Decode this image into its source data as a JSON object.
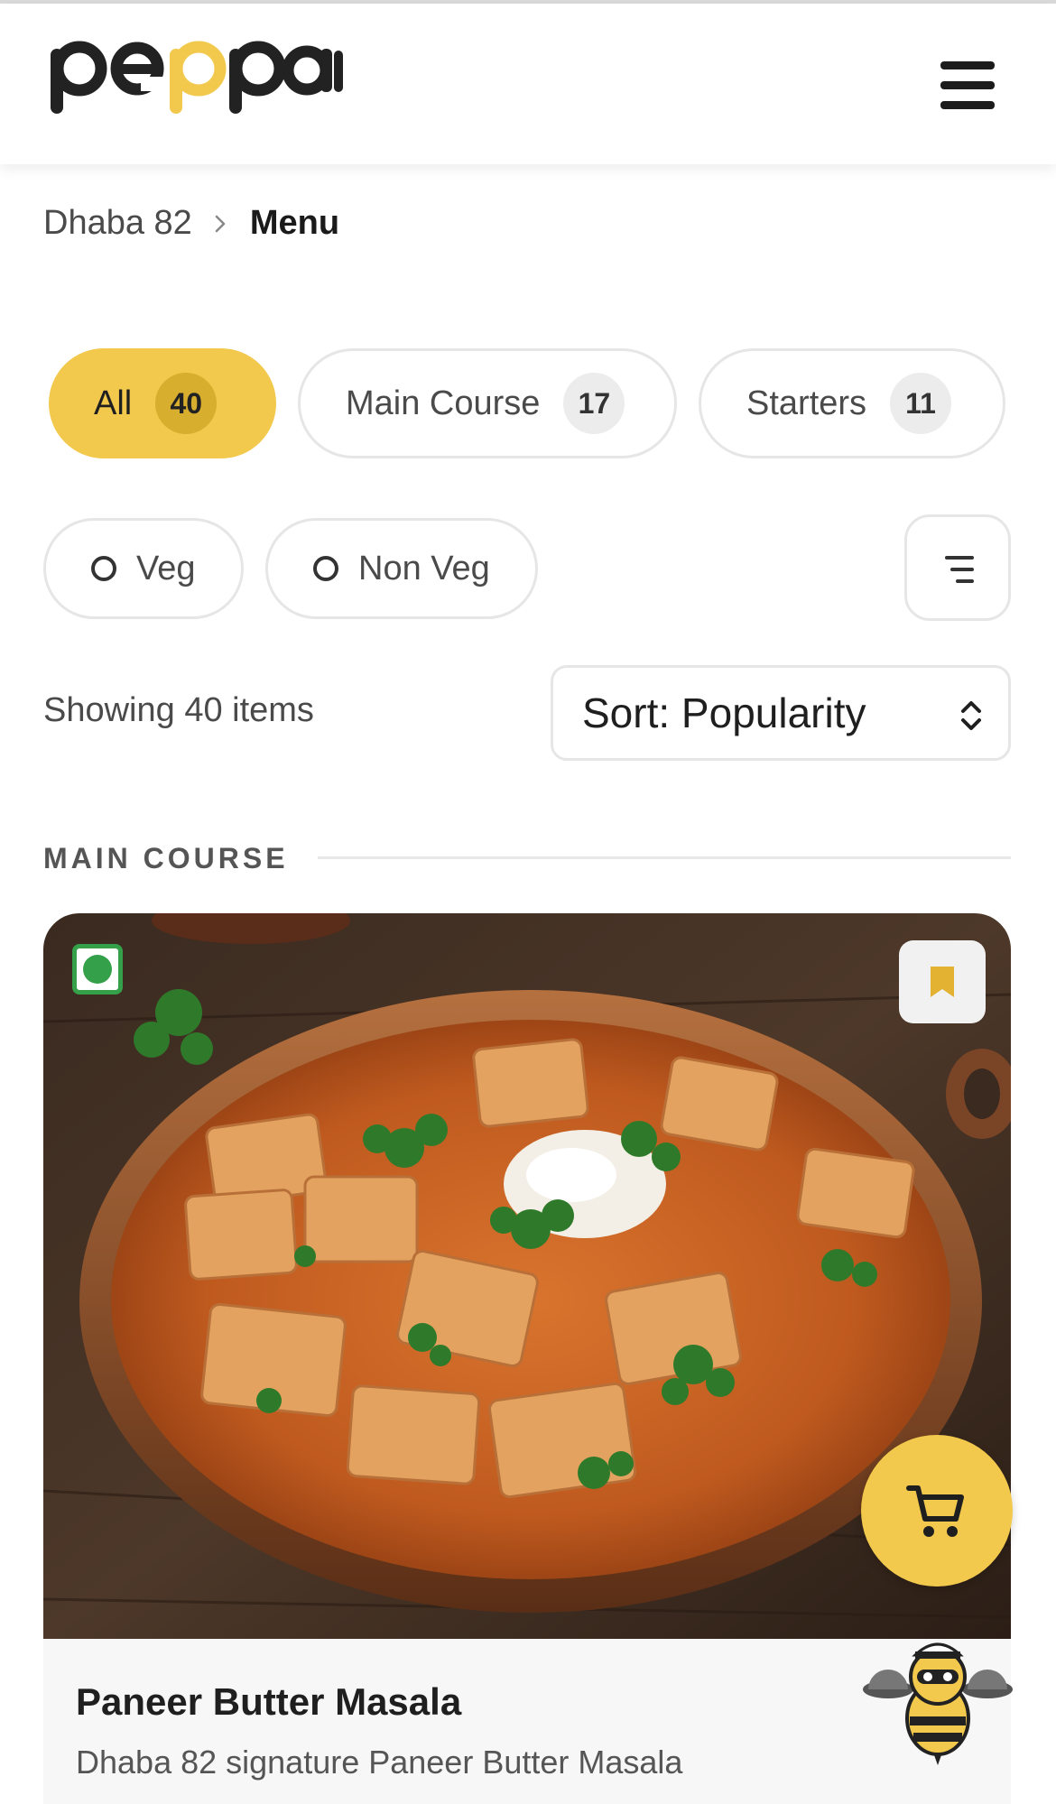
{
  "header": {
    "logo_text": "peppar",
    "menu_icon": "hamburger-icon"
  },
  "breadcrumb": {
    "home": "Dhaba 82",
    "separator_icon": "chevron-right-icon",
    "current": "Menu"
  },
  "categories": [
    {
      "label": "All",
      "count": "40",
      "active": true
    },
    {
      "label": "Main Course",
      "count": "17",
      "active": false
    },
    {
      "label": "Starters",
      "count": "11",
      "active": false
    }
  ],
  "diet_filters": [
    {
      "label": "Veg",
      "selected": false
    },
    {
      "label": "Non Veg",
      "selected": false
    }
  ],
  "filter_icon": "filter-lines-icon",
  "results": {
    "showing_text": "Showing 40 items",
    "sort_label": "Sort: Popularity",
    "sort_icon": "chevron-up-down-icon"
  },
  "section": {
    "title": "MAIN COURSE"
  },
  "item": {
    "name": "Paneer Butter Masala",
    "description": "Dhaba 82 signature Paneer Butter Masala",
    "veg_indicator": "veg-dot-icon",
    "bookmark_icon": "bookmark-icon"
  },
  "fab": {
    "cart_icon": "cart-icon",
    "mascot_icon": "bee-chef-mascot-icon"
  },
  "colors": {
    "accent": "#f2c94c",
    "accent_dark": "#d8ae2f",
    "veg_green": "#35a04a",
    "border": "#e6e6e6",
    "text": "#1f1f1f",
    "muted_text": "#4a4a4a"
  }
}
